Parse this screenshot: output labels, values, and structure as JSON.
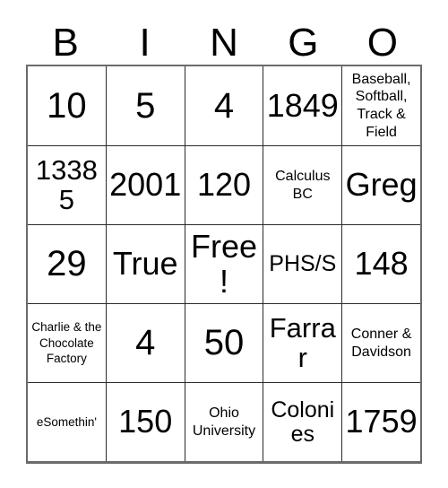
{
  "card": {
    "header": {
      "letters": [
        "B",
        "I",
        "N",
        "G",
        "O"
      ]
    },
    "free_space_label": "Free!",
    "colors": {
      "background": "#ffffff",
      "text": "#000000",
      "grid_line": "#2a2a2a",
      "outer_border": "#6b6b6b"
    },
    "rows": [
      [
        {
          "text": "10",
          "size": "xl"
        },
        {
          "text": "5",
          "size": "xl"
        },
        {
          "text": "4",
          "size": "xl"
        },
        {
          "text": "1849",
          "size": "lg"
        },
        {
          "text": "Baseball, Softball, Track & Field",
          "size": "xs"
        }
      ],
      [
        {
          "text": "13385",
          "size": "md"
        },
        {
          "text": "2001",
          "size": "lg"
        },
        {
          "text": "120",
          "size": "lg"
        },
        {
          "text": "Calculus BC",
          "size": "xs"
        },
        {
          "text": "Greg",
          "size": "lg"
        }
      ],
      [
        {
          "text": "29",
          "size": "xl"
        },
        {
          "text": "True",
          "size": "lg"
        },
        {
          "text": "Free!",
          "size": "lg"
        },
        {
          "text": "PHS/S",
          "size": "sm"
        },
        {
          "text": "148",
          "size": "lg"
        }
      ],
      [
        {
          "text": "Charlie & the Chocolate Factory",
          "size": "xxs"
        },
        {
          "text": "4",
          "size": "xl"
        },
        {
          "text": "50",
          "size": "xl"
        },
        {
          "text": "Farrar",
          "size": "md"
        },
        {
          "text": "Conner & Davidson",
          "size": "xs"
        }
      ],
      [
        {
          "text": "eSomethin'",
          "size": "xxs"
        },
        {
          "text": "150",
          "size": "lg"
        },
        {
          "text": "Ohio University",
          "size": "xs"
        },
        {
          "text": "Colonies",
          "size": "sm"
        },
        {
          "text": "1759",
          "size": "lg"
        }
      ]
    ]
  }
}
